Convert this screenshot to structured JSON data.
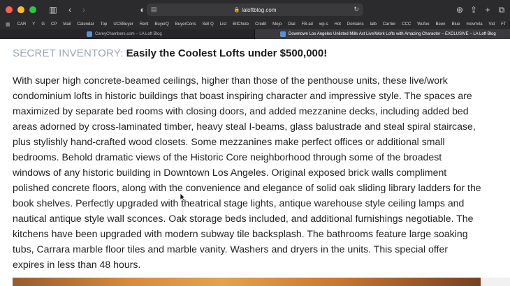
{
  "browser": {
    "url": "lalo​ftblog.com",
    "bookmarks": [
      "CAR",
      "Y",
      "G",
      "CP",
      "Mail",
      "Calendar",
      "Top",
      "UCSBuyer",
      "Rent",
      "BuyerQ",
      "BuyerCons",
      "Sell Q",
      "List",
      "BitChute",
      "Credit",
      "Mojo",
      "Dial",
      "FB-ad",
      "wp-s",
      "Hot",
      "Domains",
      "lalb",
      "Carrier",
      "CCC",
      "Wufoo",
      "Been",
      "Blue",
      "movm4a",
      "Vid",
      "FT",
      "T"
    ],
    "tabs": [
      {
        "label": "CareyChambers.com – LA Loft Blog",
        "active": false
      },
      {
        "label": "Downtown Los Angeles Unlisted Mills Act Live/Work Lofts with Amazing Character – EXCLUSIVE – LA Loft Blog",
        "active": true
      }
    ]
  },
  "article": {
    "kicker": "SECRET INVENTORY:",
    "title": "Easily the Coolest Lofts under $500,000!",
    "body": "With super high concrete-beamed ceilings, higher than those of the penthouse units, these live/work condominium lofts in historic buildings that boast inspiring character and impressive style. The spaces are maximized by separate bed rooms with closing doors, and added mezzanine decks, including added bed areas adorned by cross-laminated timber, heavy steal I-beams, glass balustrade and steal spiral staircase, plus stylishly hand-crafted wood closets. Some mezzanines make perfect offices or additional small bedrooms. Behold dramatic views of the Historic Core neighborhood through some of the broadest windows of any historic building in Downtown Los Angeles. Original exposed brick walls compliment polished concrete floors, along with the convenience and elegance of solid oak sliding library ladders for the book shelves. Perfectly upgraded with theatrical stage lights, antique warehouse style ceiling lamps and nautical antique style wall sconces. Oak storage beds included, and additional furnishings negotiable. The kitchens have been upgraded with modern subway tile backsplash. The bathrooms feature large soaking tubs, Carrara marble floor tiles and marble vanity. Washers and dryers in the units. This special offer expires in less than 48 hours."
  },
  "icons": [
    "sidebar-icon",
    "back-icon",
    "forward-icon",
    "shield-icon",
    "page-icon",
    "lock-icon",
    "reload-icon",
    "download-icon",
    "share-icon",
    "new-tab-icon",
    "tab-overview-icon"
  ]
}
